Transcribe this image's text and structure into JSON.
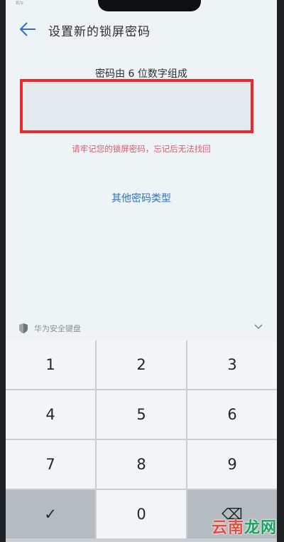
{
  "status_bar": {
    "text": "B/s"
  },
  "header": {
    "title": "设置新的锁屏密码",
    "back_icon": "back-arrow-icon"
  },
  "main": {
    "hint": "密码由 6 位数字组成",
    "password_value": "",
    "warning": "请牢记您的锁屏密码，忘记后无法找回",
    "other_types_link": "其他密码类型"
  },
  "keyboard": {
    "label": "华为安全键盘",
    "shield_icon": "shield-icon",
    "collapse_icon": "chevron-down-icon",
    "keys": [
      "1",
      "2",
      "3",
      "4",
      "5",
      "6",
      "7",
      "8",
      "9",
      "✓",
      "0",
      "⌫"
    ]
  },
  "watermark": {
    "text_a": "云南",
    "text_b": "龙网"
  },
  "colors": {
    "accent_link": "#2a73c8",
    "warning": "#d85b73",
    "highlight": "#ea2a2a"
  }
}
